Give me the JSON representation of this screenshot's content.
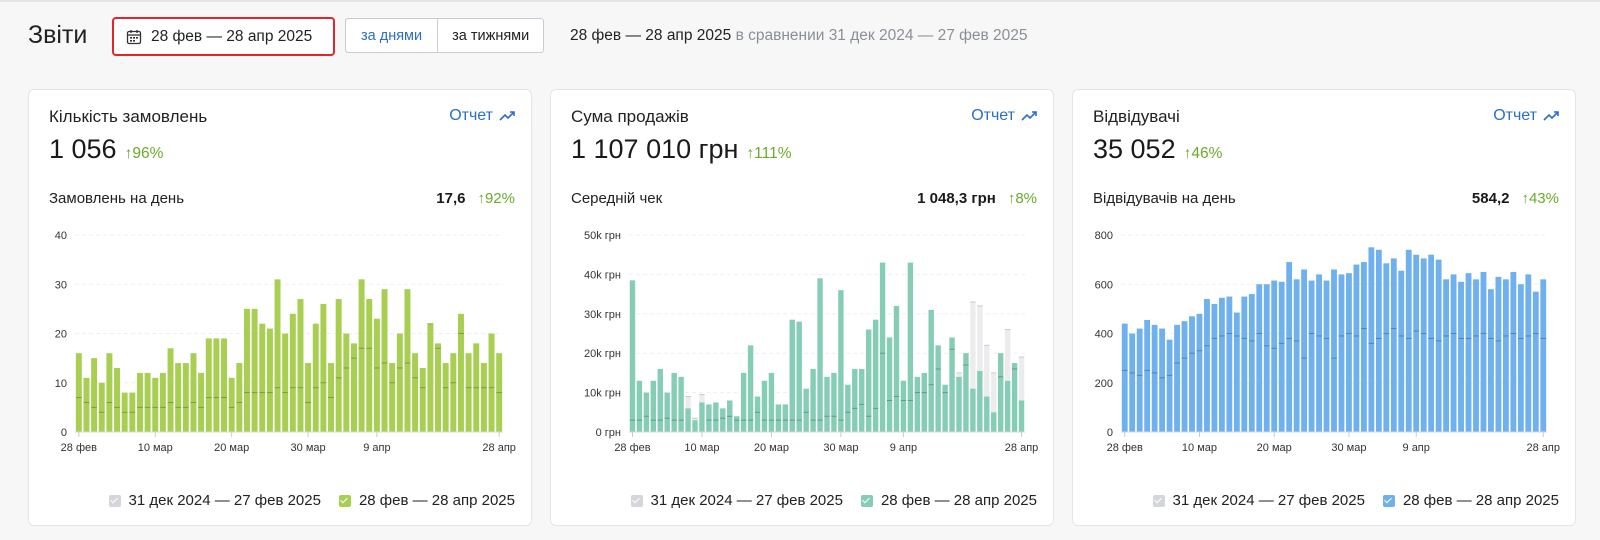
{
  "header": {
    "title": "Звіти",
    "date_range": "28 фев — 28 апр 2025",
    "segment": [
      {
        "label": "за днями",
        "active": true
      },
      {
        "label": "за тижнями",
        "active": false
      }
    ],
    "compare_range": "28 фев — 28 апр 2025",
    "compare_text": "в сравнении 31 дек 2024 — 27 фев 2025"
  },
  "colors": {
    "orders": "#a8cf52",
    "sales": "#86cdb6",
    "visitors": "#6fb0ee",
    "previous": "#e6e7e9",
    "positive": "#6aaa2a",
    "link": "#2a6ec6",
    "highlight": "#e3262a"
  },
  "cards": [
    {
      "title": "Кількість замовлень",
      "report_label": "Отчет",
      "value": "1 056",
      "delta": "↑96%",
      "sub_label": "Замовлень на день",
      "sub_value": "17,6",
      "sub_delta": "↑92%",
      "legend": [
        "31 дек 2024 — 27 фев 2025",
        "28 фев — 28 апр 2025"
      ]
    },
    {
      "title": "Сума продажів",
      "report_label": "Отчет",
      "value": "1 107 010 грн",
      "delta": "↑111%",
      "sub_label": "Середній чек",
      "sub_value": "1 048,3 грн",
      "sub_delta": "↑8%",
      "legend": [
        "31 дек 2024 — 27 фев 2025",
        "28 фев — 28 апр 2025"
      ]
    },
    {
      "title": "Відвідувачі",
      "report_label": "Отчет",
      "value": "35 052",
      "delta": "↑46%",
      "sub_label": "Відвідувачів на день",
      "sub_value": "584,2",
      "sub_delta": "↑43%",
      "legend": [
        "31 дек 2024 — 27 фев 2025",
        "28 фев — 28 апр 2025"
      ]
    }
  ],
  "chart_data": [
    {
      "type": "bar",
      "x_labels": [
        "28 фев",
        "10 мар",
        "20 мар",
        "30 мар",
        "9 апр",
        "28 апр"
      ],
      "y_ticks": [
        "0",
        "10",
        "20",
        "30",
        "40"
      ],
      "ylim": [
        0,
        40
      ],
      "series": [
        {
          "name": "28 фев — 28 апр 2025",
          "values": [
            16,
            11,
            15,
            10,
            16,
            13,
            8,
            8,
            12,
            12,
            11,
            12,
            17,
            14,
            14,
            16,
            12,
            19,
            19,
            19,
            11,
            14,
            25,
            25,
            22,
            21,
            31,
            20,
            24,
            27,
            14,
            22,
            26,
            14,
            27,
            20,
            18,
            31,
            27,
            23,
            29,
            14,
            20,
            29,
            16,
            13,
            22,
            18,
            14,
            16,
            24,
            16,
            18,
            14,
            20,
            16
          ]
        },
        {
          "name": "31 дек 2024 — 27 фев 2025",
          "values": [
            7,
            6,
            5,
            4,
            6,
            5,
            4,
            4,
            5,
            5,
            5,
            5,
            6,
            5,
            5,
            6,
            5,
            7,
            7,
            7,
            5,
            6,
            8,
            8,
            8,
            8,
            9,
            8,
            9,
            9,
            6,
            9,
            10,
            7,
            11,
            13,
            15,
            17,
            17,
            13,
            14,
            10,
            13,
            14,
            11,
            9,
            22,
            17,
            9,
            10,
            20,
            9,
            9,
            9,
            9,
            8
          ]
        }
      ]
    },
    {
      "type": "bar",
      "x_labels": [
        "28 фев",
        "10 мар",
        "20 мар",
        "30 мар",
        "9 апр",
        "28 апр"
      ],
      "y_ticks": [
        "0 грн",
        "10k грн",
        "20k грн",
        "30k грн",
        "40k грн",
        "50k грн"
      ],
      "ylim": [
        0,
        50000
      ],
      "series": [
        {
          "name": "28 фев — 28 апр 2025",
          "values": [
            38500,
            13000,
            10000,
            13000,
            16000,
            10000,
            15000,
            14000,
            6000,
            3000,
            7500,
            7000,
            7500,
            6000,
            8000,
            4000,
            15000,
            22000,
            9000,
            13000,
            15000,
            7000,
            7000,
            28500,
            28000,
            11000,
            16000,
            39000,
            14000,
            15000,
            36000,
            12000,
            16000,
            16000,
            26000,
            28500,
            43000,
            24000,
            32000,
            13000,
            43000,
            14000,
            15000,
            31000,
            22000,
            12000,
            24000,
            14000,
            20000,
            11000,
            15500,
            9000,
            5000,
            20000,
            13000,
            17500,
            8000
          ]
        },
        {
          "name": "31 дек 2024 — 27 фев 2025",
          "values": [
            3000,
            3000,
            4000,
            3000,
            3000,
            3500,
            3000,
            3000,
            9000,
            3500,
            9500,
            3000,
            3000,
            3500,
            4000,
            3000,
            3000,
            3000,
            5000,
            3000,
            3000,
            3000,
            3000,
            3000,
            3000,
            5000,
            3000,
            3000,
            4000,
            4000,
            3000,
            5000,
            6000,
            7000,
            4000,
            6000,
            20000,
            8000,
            9000,
            8000,
            8000,
            10000,
            10000,
            12000,
            16000,
            10000,
            21000,
            15000,
            17000,
            33000,
            32000,
            22000,
            15000,
            14000,
            26000,
            16000,
            19000
          ]
        }
      ]
    },
    {
      "type": "bar",
      "x_labels": [
        "28 фев",
        "10 мар",
        "20 мар",
        "30 мар",
        "9 апр",
        "28 апр"
      ],
      "y_ticks": [
        "0",
        "200",
        "400",
        "600",
        "800"
      ],
      "ylim": [
        0,
        800
      ],
      "series": [
        {
          "name": "28 фев — 28 апр 2025",
          "values": [
            440,
            400,
            420,
            455,
            435,
            420,
            375,
            435,
            450,
            470,
            480,
            540,
            520,
            545,
            550,
            485,
            550,
            560,
            600,
            600,
            615,
            610,
            690,
            620,
            660,
            615,
            640,
            615,
            660,
            640,
            645,
            680,
            690,
            750,
            740,
            685,
            705,
            655,
            740,
            720,
            705,
            720,
            700,
            620,
            640,
            610,
            645,
            620,
            650,
            580,
            630,
            620,
            650,
            600,
            640,
            570,
            620
          ]
        },
        {
          "name": "31 дек 2024 — 27 фев 2025",
          "values": [
            250,
            240,
            230,
            250,
            240,
            220,
            230,
            280,
            300,
            320,
            330,
            350,
            380,
            390,
            400,
            390,
            380,
            370,
            400,
            350,
            340,
            360,
            380,
            370,
            300,
            400,
            390,
            380,
            300,
            390,
            400,
            390,
            420,
            360,
            380,
            400,
            420,
            390,
            380,
            410,
            400,
            380,
            370,
            390,
            400,
            380,
            380,
            390,
            400,
            380,
            370,
            390,
            400,
            380,
            390,
            400,
            380
          ]
        }
      ]
    }
  ]
}
